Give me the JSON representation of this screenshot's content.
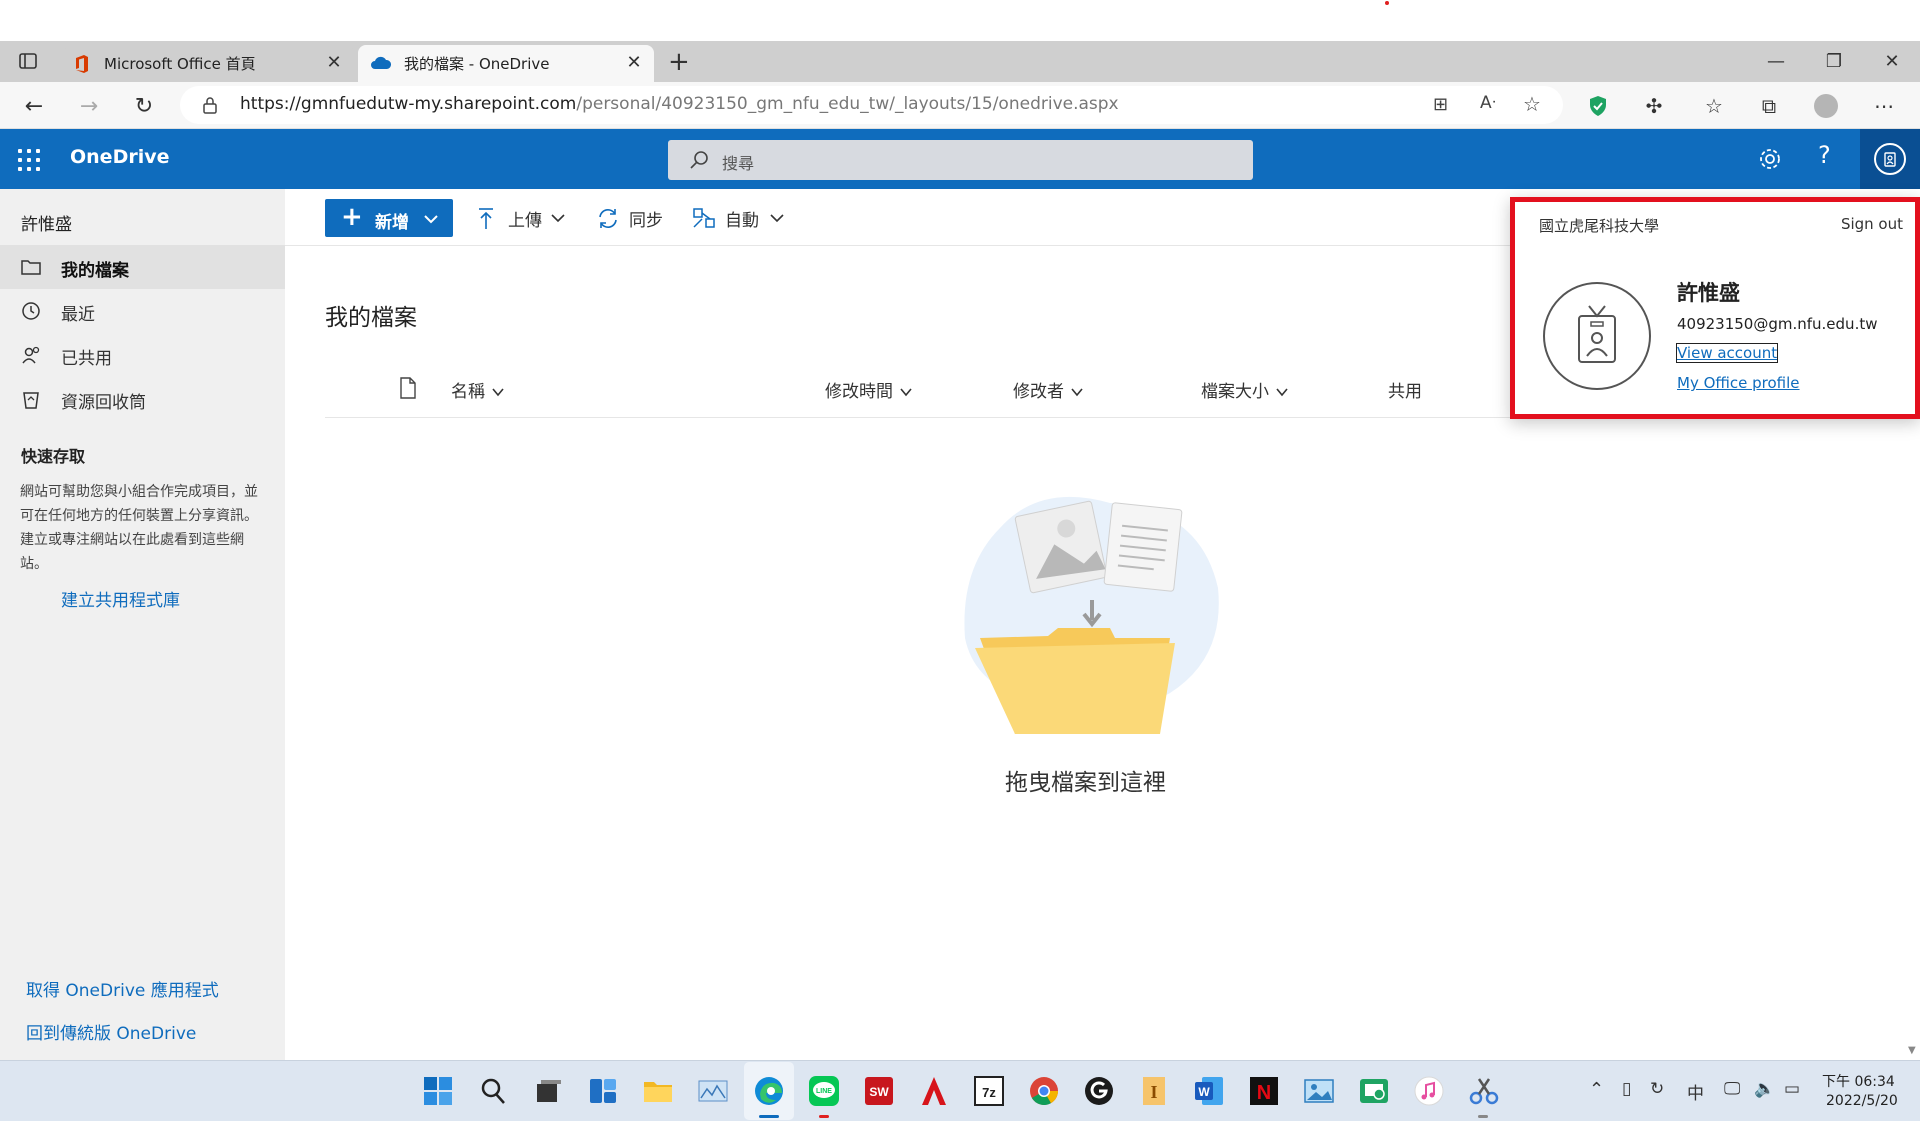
{
  "browser": {
    "tabs": [
      {
        "title": "Microsoft Office 首頁"
      },
      {
        "title": "我的檔案 - OneDrive"
      }
    ],
    "url_host": "https://gmnfuedutw-my.sharepoint.com",
    "url_path": "/personal/40923150_gm_nfu_edu_tw/_layouts/15/onedrive.aspx"
  },
  "header": {
    "app_name": "OneDrive",
    "search_placeholder": "搜尋"
  },
  "sidebar": {
    "user_name": "許惟盛",
    "items": [
      {
        "label": "我的檔案",
        "icon": "folder-icon"
      },
      {
        "label": "最近",
        "icon": "history-icon"
      },
      {
        "label": "已共用",
        "icon": "people-icon"
      },
      {
        "label": "資源回收筒",
        "icon": "recycle-bin-icon"
      }
    ],
    "quick_access_title": "快速存取",
    "quick_access_desc": "網站可幫助您與小組合作完成項目，並可在任何地方的任何裝置上分享資訊。建立或專注網站以在此處看到這些網站。",
    "create_library": "建立共用程式庫",
    "get_app": "取得 OneDrive 應用程式",
    "classic": "回到傳統版 OneDrive"
  },
  "commands": {
    "new": "新增",
    "upload": "上傳",
    "sync": "同步",
    "automate": "自動"
  },
  "main": {
    "page_title": "我的檔案",
    "columns": [
      "名稱",
      "修改時間",
      "修改者",
      "檔案大小",
      "共用"
    ],
    "empty_text": "拖曳檔案到這裡"
  },
  "account_panel": {
    "org": "國立虎尾科技大學",
    "sign_out": "Sign out",
    "name": "許惟盛",
    "email": "40923150@gm.nfu.edu.tw",
    "view_account": "View account",
    "office_profile": "My Office profile"
  },
  "taskbar": {
    "time": "下午 06:34",
    "date": "2022/5/20",
    "ime": "中"
  },
  "colors": {
    "brand": "#0f6cbd",
    "highlight_border": "#e3101e"
  }
}
